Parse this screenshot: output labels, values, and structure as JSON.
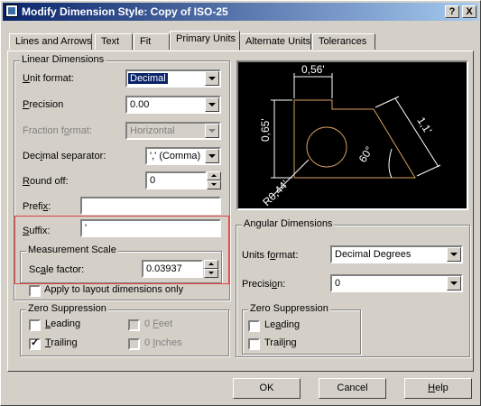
{
  "window": {
    "title": "Modify Dimension Style: Copy of ISO-25",
    "help_btn": "?",
    "close_btn": "X"
  },
  "tabs": [
    "Lines and Arrows",
    "Text",
    "Fit",
    "Primary Units",
    "Alternate Units",
    "Tolerances"
  ],
  "active_tab": "Primary Units",
  "linear": {
    "legend": "Linear Dimensions",
    "unit_format": {
      "label_u": "U",
      "label_rest": "nit format:",
      "value": "Decimal"
    },
    "precision": {
      "label_u": "P",
      "label_rest": "recision",
      "value": "0.00"
    },
    "fraction_format": {
      "label_pre": "Fraction f",
      "label_u": "o",
      "label_post": "rmat:",
      "value": "Horizontal"
    },
    "decimal_separator": {
      "label_pre": "Dec",
      "label_u": "i",
      "label_post": "mal separator:",
      "value": "',' (Comma)"
    },
    "round_off": {
      "label_u": "R",
      "label_rest": "ound off:",
      "value": "0"
    },
    "prefix": {
      "label_pre": "Prefi",
      "label_u": "x",
      "label_post": ":",
      "value": ""
    },
    "suffix": {
      "label_u": "S",
      "label_rest": "uffix:",
      "value": "'"
    },
    "measurement_scale": {
      "legend": "Measurement Scale",
      "scale_factor_pre": "Sc",
      "scale_factor_u": "a",
      "scale_factor_post": "le factor:",
      "value": "0.03937"
    },
    "apply_layout": {
      "label": "Apply to layout dimensions only",
      "checked": false
    }
  },
  "zero_suppression_linear": {
    "legend": "Zero Suppression",
    "leading": {
      "u": "L",
      "rest": "eading",
      "checked": false
    },
    "trailing": {
      "u": "T",
      "rest": "railing",
      "checked": true
    },
    "feet": {
      "pre": "0 ",
      "u": "F",
      "rest": "eet",
      "checked": false
    },
    "inches": {
      "pre": "0 ",
      "u": "I",
      "rest": "nches",
      "checked": false
    }
  },
  "preview": {
    "dim_top": "0,56'",
    "dim_left": "0,65'",
    "dim_right": "1,1'",
    "angle": "60°",
    "radius": "R0,44'"
  },
  "angular": {
    "legend": "Angular Dimensions",
    "units_format": {
      "label_pre": "Units f",
      "label_u": "o",
      "label_post": "rmat:",
      "value": "Decimal Degrees"
    },
    "precision": {
      "label_pre": "Precisi",
      "label_u": "o",
      "label_post": "n:",
      "value": "0"
    }
  },
  "zero_suppression_angular": {
    "legend": "Zero Suppression",
    "leading": {
      "pre": "Le",
      "u": "a",
      "rest": "ding",
      "checked": false
    },
    "trailing": {
      "pre": "Trail",
      "u": "i",
      "rest": "ng",
      "checked": false
    }
  },
  "buttons": {
    "ok": "OK",
    "cancel": "Cancel",
    "help_u": "H",
    "help_rest": "elp"
  }
}
